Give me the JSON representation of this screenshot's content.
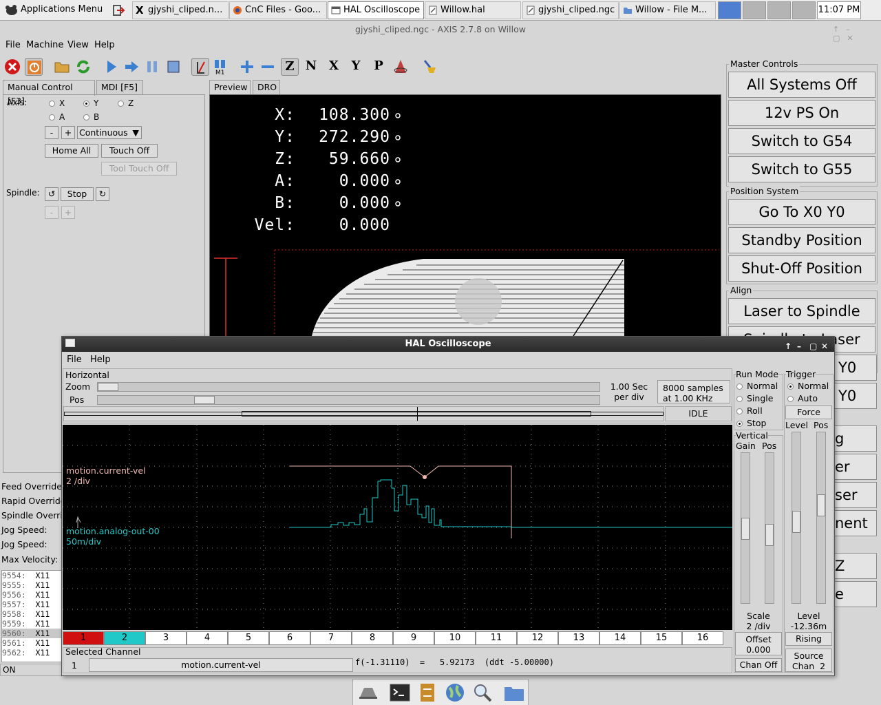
{
  "taskbar": {
    "app_menu": "Applications Menu",
    "windows": [
      {
        "label": "gjyshi_cliped.n...",
        "icon": "x-icon"
      },
      {
        "label": "CnC Files - Goo...",
        "icon": "firefox-icon"
      },
      {
        "label": "HAL Oscilloscope",
        "icon": "window-icon"
      },
      {
        "label": "Willow.hal",
        "icon": "text-editor-icon"
      },
      {
        "label": "gjyshi_cliped.ngc",
        "icon": "text-editor-icon"
      },
      {
        "label": "Willow - File M...",
        "icon": "folder-icon"
      }
    ],
    "clock": "11:07 PM"
  },
  "axis": {
    "title": "gjyshi_cliped.ngc - AXIS 2.7.8 on Willow",
    "menu": [
      "File",
      "Machine",
      "View",
      "Help"
    ],
    "left_tabs": [
      "Manual Control [F3]",
      "MDI [F5]"
    ],
    "preview_tabs": [
      "Preview",
      "DRO"
    ],
    "manual": {
      "axis_label": "Axis:",
      "axes": [
        "X",
        "Y",
        "Z",
        "A",
        "B"
      ],
      "selected_axis": "Y",
      "minus": "-",
      "plus": "+",
      "jog_mode": "Continuous",
      "home_all": "Home All",
      "touch_off": "Touch Off",
      "tool_touch_off": "Tool Touch Off",
      "spindle_label": "Spindle:",
      "spindle_stop": "Stop",
      "spindle_minus": "-",
      "spindle_plus": "+"
    },
    "dro": [
      {
        "axis": "X:",
        "value": "108.300"
      },
      {
        "axis": "Y:",
        "value": "272.290"
      },
      {
        "axis": "Z:",
        "value": "59.660"
      },
      {
        "axis": "A:",
        "value": "0.000"
      },
      {
        "axis": "B:",
        "value": "0.000"
      },
      {
        "axis": "Vel:",
        "value": "0.000"
      }
    ],
    "overrides": [
      "Feed Override:",
      "Rapid Override",
      "Spindle Overri",
      "Jog Speed:",
      "Jog Speed:",
      "Max Velocity:"
    ],
    "gcode_lines": [
      {
        "n": "9554:",
        "t": "X11"
      },
      {
        "n": "9555:",
        "t": "X11"
      },
      {
        "n": "9556:",
        "t": "X11"
      },
      {
        "n": "9557:",
        "t": "X11"
      },
      {
        "n": "9558:",
        "t": "X11"
      },
      {
        "n": "9559:",
        "t": "X11"
      },
      {
        "n": "9560:",
        "t": "X11"
      },
      {
        "n": "9561:",
        "t": "X11"
      },
      {
        "n": "9562:",
        "t": "X11"
      }
    ],
    "status": "ON",
    "master_controls": {
      "label": "Master Controls",
      "buttons": [
        "All Systems Off",
        "12v PS On",
        "Switch to G54",
        "Switch to G55"
      ]
    },
    "position_system": {
      "label": "Position System",
      "buttons": [
        "Go To X0 Y0",
        "Standby Position",
        "Shut-Off Position"
      ]
    },
    "align": {
      "label": "Align",
      "buttons": [
        "Laser to Spindle"
      ],
      "partial": "Spindle to Laser"
    },
    "clipped_buttons": [
      "Y0",
      "Y0",
      "g",
      "er",
      "ser",
      "nent",
      "Z",
      "e"
    ]
  },
  "scope": {
    "title": "HAL Oscilloscope",
    "menu": [
      "File",
      "Help"
    ],
    "horizontal": {
      "label": "Horizontal",
      "zoom_label": "Zoom",
      "pos_label": "Pos",
      "rate_line1": "1.00 Sec",
      "rate_line2": "per div",
      "samples_line1": "8000 samples",
      "samples_line2": "at 1.00 KHz",
      "state": "IDLE"
    },
    "run_mode": {
      "label": "Run Mode",
      "options": [
        "Normal",
        "Single",
        "Roll",
        "Stop"
      ],
      "selected": "Stop"
    },
    "trigger": {
      "label": "Trigger",
      "options": [
        "Normal",
        "Auto"
      ],
      "selected": "Normal",
      "force": "Force",
      "level_label": "Level",
      "pos_label": "Pos",
      "level_title": "Level",
      "level_value": "-12.36m",
      "rising": "Rising",
      "source_line1": "Source",
      "source_line2": "Chan  2"
    },
    "vertical": {
      "label": "Vertical",
      "gain_label": "Gain",
      "pos_label": "Pos",
      "scale_line1": "Scale",
      "scale_line2": "2 /div",
      "offset_line1": "Offset",
      "offset_line2": "0.000",
      "chan_off": "Chan Off"
    },
    "traces": [
      {
        "name": "motion.current-vel",
        "scale": "2 /div",
        "color": "#f0b8b0"
      },
      {
        "name": "motion.analog-out-00",
        "scale": "50m/div",
        "color": "#20c8c8"
      }
    ],
    "channels": [
      "1",
      "2",
      "3",
      "4",
      "5",
      "6",
      "7",
      "8",
      "9",
      "10",
      "11",
      "12",
      "13",
      "14",
      "15",
      "16"
    ],
    "channel_colors": {
      "1": "#d01010",
      "2": "#20c8c8"
    },
    "selected_channel": {
      "label": "Selected Channel",
      "number": "1",
      "name": "motion.current-vel",
      "readout": "f(-1.31110)  =   5.92173  (ddt -5.00000)"
    }
  }
}
